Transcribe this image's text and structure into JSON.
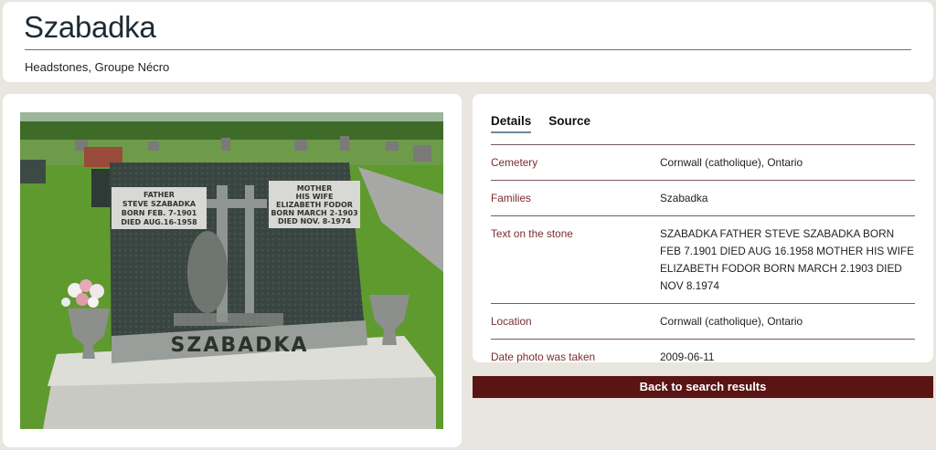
{
  "header": {
    "title": "Szabadka",
    "breadcrumb": "Headstones, Groupe Nécro"
  },
  "photo": {
    "stone_left_lines": [
      "FATHER",
      "STEVE SZABADKA",
      "BORN FEB. 7-1901",
      "DIED AUG.16-1958"
    ],
    "stone_right_lines": [
      "MOTHER",
      "HIS WIFE",
      "ELIZABETH FODOR",
      "BORN MARCH 2-1903",
      "DIED NOV. 8-1974"
    ],
    "stone_name": "SZABADKA"
  },
  "tabs": [
    {
      "label": "Details"
    },
    {
      "label": "Source"
    }
  ],
  "details": [
    {
      "label": "Cemetery",
      "value": "Cornwall (catholique), Ontario"
    },
    {
      "label": "Families",
      "value": "Szabadka"
    },
    {
      "label": "Text on the stone",
      "value": "SZABADKA FATHER STEVE SZABADKA BORN FEB 7.1901 DIED AUG 16.1958 MOTHER HIS WIFE ELIZABETH FODOR BORN MARCH 2.1903 DIED NOV 8.1974"
    },
    {
      "label": "Location",
      "value": "Cornwall (catholique), Ontario"
    },
    {
      "label": "Date photo was taken",
      "value": "2009-06-11"
    }
  ],
  "back_button": "Back to search results"
}
